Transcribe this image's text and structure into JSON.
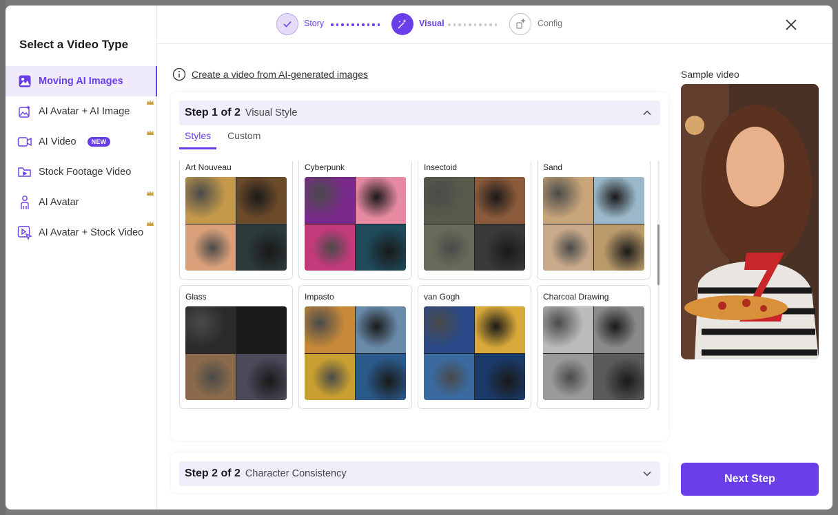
{
  "sidebar": {
    "title": "Select a Video Type",
    "items": [
      {
        "label": "Moving AI Images",
        "icon": "image-icon",
        "active": true,
        "premium": false
      },
      {
        "label": "AI Avatar + AI Image",
        "icon": "sparkle-image-icon",
        "active": false,
        "premium": true
      },
      {
        "label": "AI Video",
        "icon": "video-camera-icon",
        "active": false,
        "premium": true,
        "badge": "NEW"
      },
      {
        "label": "Stock Footage Video",
        "icon": "folder-video-icon",
        "active": false,
        "premium": false
      },
      {
        "label": "AI Avatar",
        "icon": "person-icon",
        "active": false,
        "premium": true
      },
      {
        "label": "AI Avatar + Stock Video",
        "icon": "play-cursor-icon",
        "active": false,
        "premium": true
      }
    ]
  },
  "stepper": {
    "steps": [
      {
        "label": "Story",
        "state": "done"
      },
      {
        "label": "Visual",
        "state": "current"
      },
      {
        "label": "Config",
        "state": "upcoming"
      }
    ]
  },
  "intro": {
    "link_text": "Create a video from AI-generated images"
  },
  "step1": {
    "number": "Step 1 of 2",
    "name": "Visual Style",
    "tabs": [
      "Styles",
      "Custom"
    ],
    "active_tab": "Styles",
    "styles": [
      {
        "label": "Art Nouveau",
        "colors": [
          "#c49a4a",
          "#6b4a2a",
          "#d9a07a",
          "#2c3a3a"
        ]
      },
      {
        "label": "Cyberpunk",
        "colors": [
          "#7a2a8a",
          "#e58aa0",
          "#c23a7a",
          "#1e4a5a"
        ]
      },
      {
        "label": "Insectoid",
        "colors": [
          "#5a5a4a",
          "#8a5a3a",
          "#6a6a5a",
          "#3a3a3a"
        ]
      },
      {
        "label": "Sand",
        "colors": [
          "#c9a67a",
          "#9ab8c9",
          "#c8a98a",
          "#b99a6a"
        ]
      },
      {
        "label": "Glass",
        "colors": [
          "#2a2a2a",
          "#1a1a1a",
          "#8a6a4a",
          "#4a4a5a"
        ]
      },
      {
        "label": "Impasto",
        "colors": [
          "#c88a3a",
          "#6a8aaa",
          "#c9a030",
          "#2a5a8a"
        ]
      },
      {
        "label": "van Gogh",
        "colors": [
          "#2a4a8a",
          "#d8a83a",
          "#3a6aa0",
          "#1a3a6a"
        ]
      },
      {
        "label": "Charcoal Drawing",
        "colors": [
          "#bcbcbc",
          "#8a8a8a",
          "#9a9a9a",
          "#5a5a5a"
        ]
      }
    ]
  },
  "step2": {
    "number": "Step 2 of 2",
    "name": "Character Consistency"
  },
  "sample": {
    "label": "Sample video"
  },
  "next_button": "Next Step",
  "accent": "#6a3ee8"
}
